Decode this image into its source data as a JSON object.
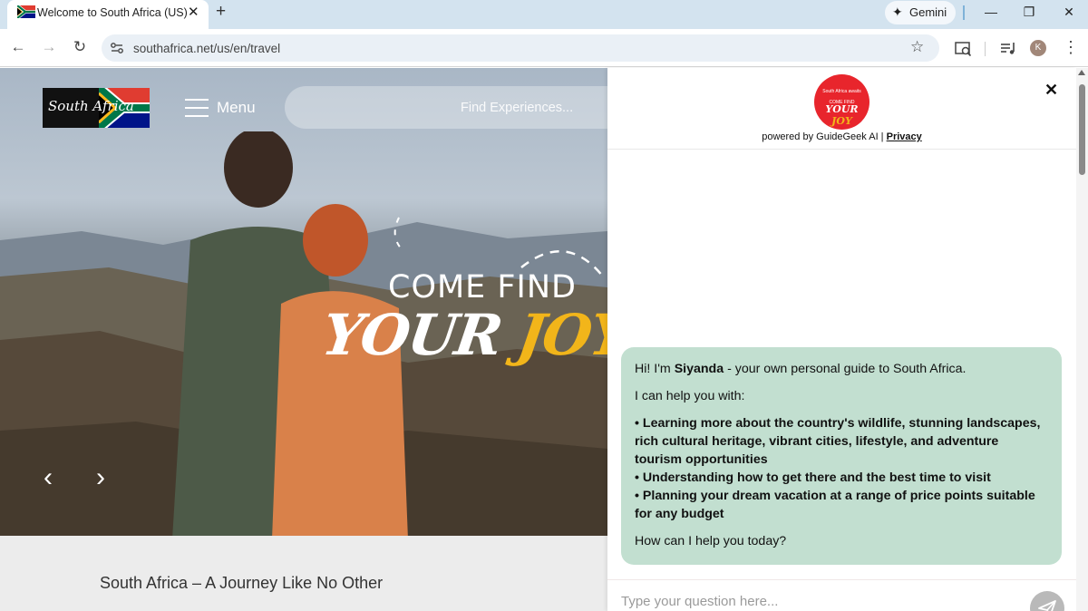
{
  "browser": {
    "tab_title": "Welcome to South Africa (US)",
    "tab_close": "✕",
    "new_tab": "+",
    "gemini_label": "Gemini",
    "url": "southafrica.net/us/en/travel",
    "profile_initial": "K",
    "window_controls": {
      "minimize": "—",
      "restore": "❐",
      "close": "✕"
    },
    "icons": [
      "back-arrow-icon",
      "forward-arrow-icon",
      "reload-icon",
      "site-settings-icon",
      "bookmark-star-icon",
      "search-in-page-icon",
      "media-controls-icon",
      "kebab-menu-icon"
    ]
  },
  "site": {
    "logo_text": "South Africa",
    "menu_label": "Menu",
    "search_placeholder": "Find Experiences...",
    "headline_line1": "COME FIND",
    "headline_line2a": "YOUR ",
    "headline_line2b": "JOY",
    "prev_arrow": "‹",
    "next_arrow": "›",
    "subtitle": "South Africa – A Journey Like No Other"
  },
  "chat": {
    "logo_small": "South Africa awaits",
    "logo_mid": "COME FIND",
    "logo_big_a": "YOUR ",
    "logo_big_b": "JOY",
    "powered_by": "powered by GuideGeek AI | ",
    "privacy_link": "Privacy",
    "close": "✕",
    "greeting_prefix": "Hi! I'm ",
    "assistant_name": "Siyanda",
    "greeting_suffix": " - your own personal guide to South Africa.",
    "help_intro": "I can help you with:",
    "bullets": [
      "• Learning more about the country's wildlife, stunning landscapes, rich cultural heritage, vibrant cities, lifestyle, and adventure tourism opportunities",
      "• Understanding how to get there and the best time to visit",
      "• Planning your dream vacation at a range of price points suitable for any budget"
    ],
    "closing_question": "How can I help you today?",
    "input_placeholder": "Type your question here..."
  },
  "colors": {
    "accent_yellow": "#f2b51a",
    "chat_bubble": "#c2dfd0",
    "logo_red": "#e8252c"
  }
}
